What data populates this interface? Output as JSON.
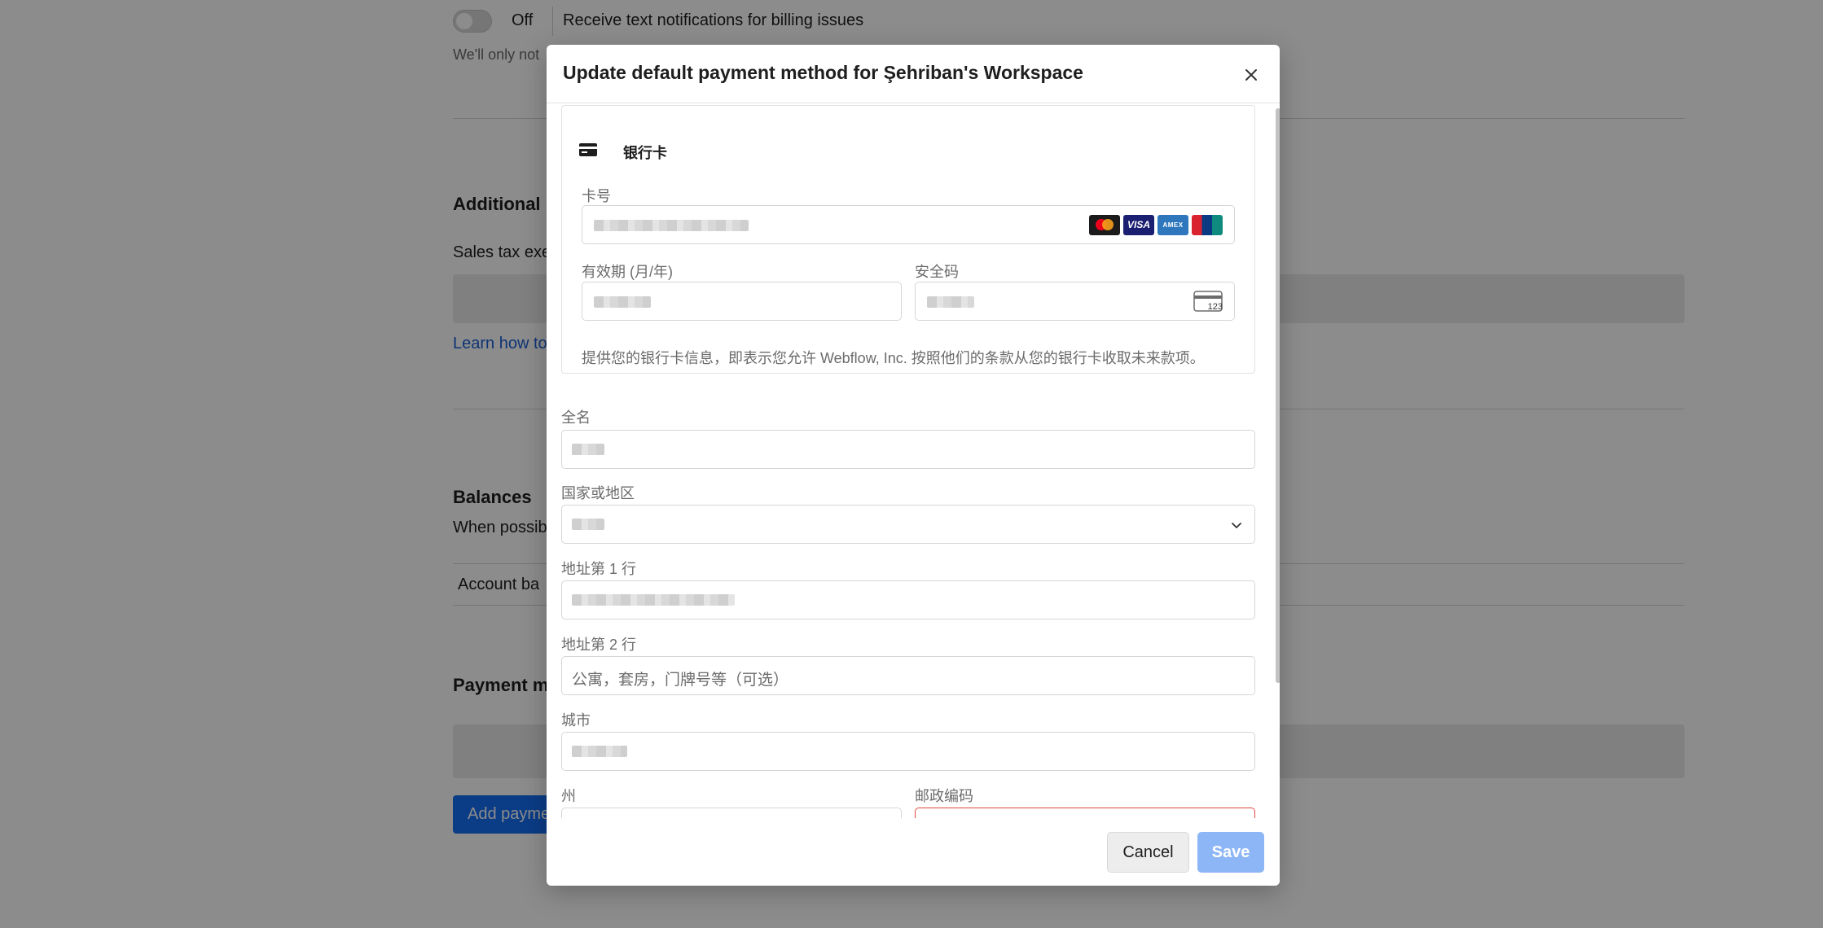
{
  "background": {
    "toggle_state": "Off",
    "notification_text": "Receive text notifications for billing issues",
    "notification_note": "We'll only not",
    "additional_heading": "Additional",
    "sales_tax_text": "Sales tax exe",
    "learn_link": "Learn how to",
    "balances_heading": "Balances",
    "balances_text": "When possib",
    "account_balance": "Account ba",
    "payment_heading": "Payment m",
    "add_payment_button": "Add payme"
  },
  "modal": {
    "title": "Update default payment method for Şehriban's Workspace",
    "card_section": {
      "method_label": "银行卡",
      "card_number_label": "卡号",
      "expiry_label": "有效期 (月/年)",
      "cvc_label": "安全码",
      "cvc_icon_text": "123",
      "disclaimer": "提供您的银行卡信息，即表示您允许 Webflow, Inc. 按照他们的条款从您的银行卡收取未来款项。",
      "card_brands": [
        "Mastercard",
        "VISA",
        "AMEX",
        "UnionPay"
      ]
    },
    "fields": {
      "full_name_label": "全名",
      "country_label": "国家或地区",
      "address1_label": "地址第 1 行",
      "address2_label": "地址第 2 行",
      "address2_placeholder": "公寓，套房，门牌号等（可选）",
      "city_label": "城市",
      "state_label": "州",
      "zip_label": "邮政编码"
    },
    "footer": {
      "cancel_label": "Cancel",
      "save_label": "Save"
    }
  },
  "colors": {
    "primary": "#146ef5",
    "save_disabled": "#8db6f6",
    "error_border": "#e2463b"
  }
}
